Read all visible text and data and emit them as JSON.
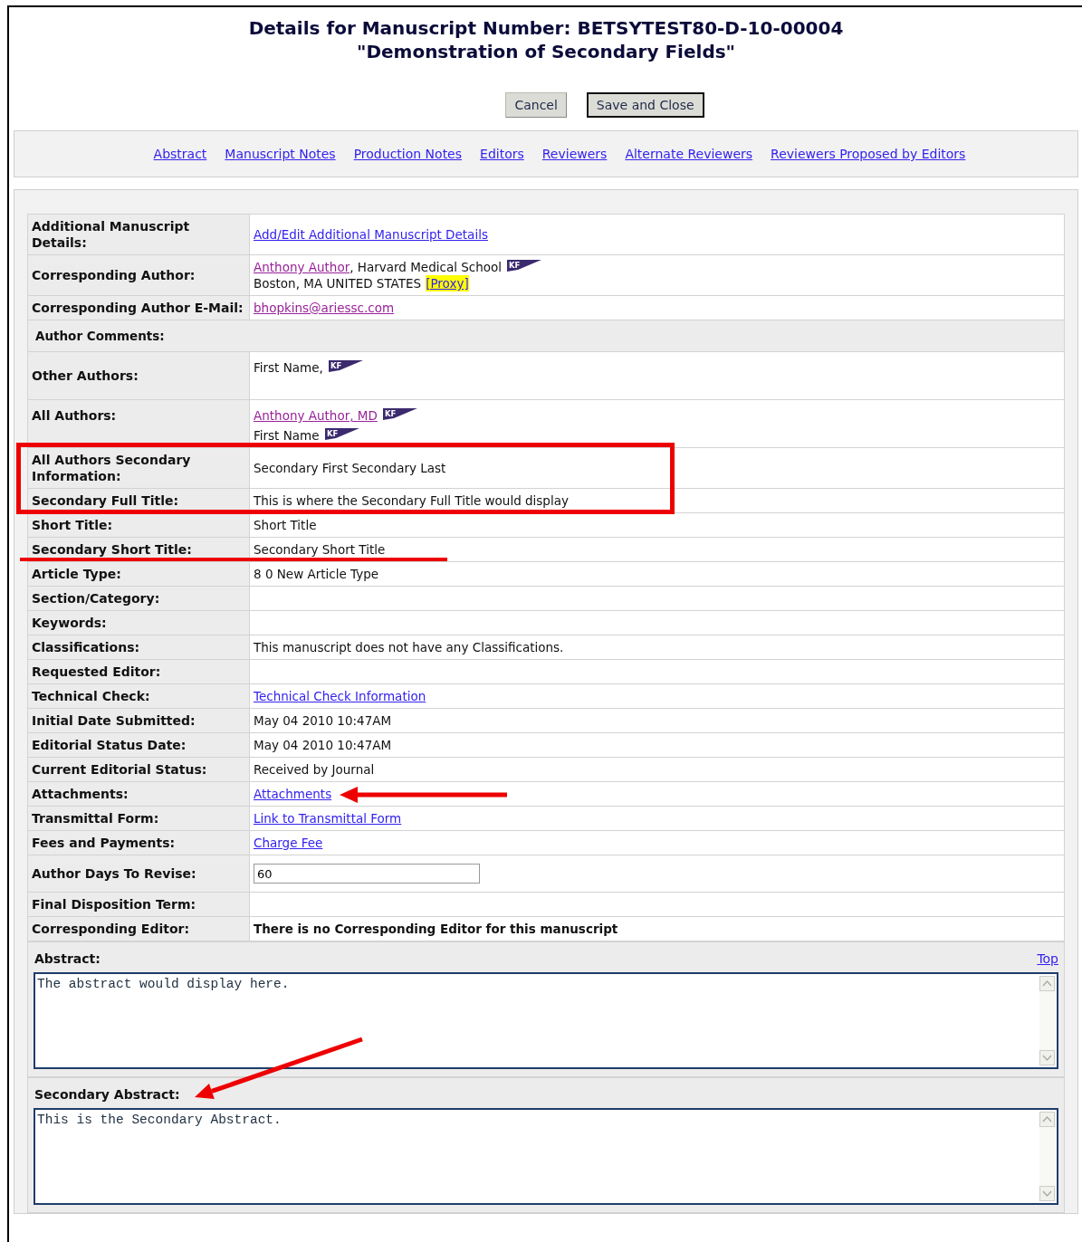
{
  "title": {
    "line1": "Details for Manuscript Number:  BETSYTEST80-D-10-00004",
    "line2": "\"Demonstration of Secondary Fields\""
  },
  "buttons": [
    {
      "label": "Cancel",
      "kind": "plain"
    },
    {
      "label": "Save and Close",
      "kind": "default"
    }
  ],
  "nav_links": [
    "Abstract",
    "Manuscript Notes",
    "Production Notes",
    "Editors",
    "Reviewers",
    "Alternate Reviewers",
    "Reviewers Proposed by Editors"
  ],
  "rows": [
    {
      "kind": "field",
      "label": "Additional Manuscript Details:",
      "lines": [
        [
          {
            "kind": "link",
            "text": "Add/Edit Additional Manuscript Details",
            "visited": false
          }
        ]
      ]
    },
    {
      "kind": "field",
      "label": "Corresponding Author:",
      "lines": [
        [
          {
            "kind": "link",
            "text": "Anthony Author",
            "visited": true
          },
          {
            "kind": "text",
            "text": ", Harvard Medical School"
          },
          {
            "kind": "flag",
            "text": "KF"
          }
        ],
        [
          {
            "kind": "text",
            "text": "Boston, MA UNITED STATES"
          },
          {
            "kind": "proxy",
            "text": "[Proxy]"
          }
        ]
      ]
    },
    {
      "kind": "field",
      "label": "Corresponding Author E-Mail:",
      "lines": [
        [
          {
            "kind": "link",
            "text": "bhopkins@ariessc.com",
            "visited": true
          }
        ]
      ]
    },
    {
      "kind": "section",
      "label": "Author Comments:"
    },
    {
      "kind": "list",
      "label": "Other Authors:",
      "lines": [
        [
          {
            "kind": "text",
            "text": "First Name,"
          },
          {
            "kind": "flag",
            "text": "KF"
          }
        ]
      ]
    },
    {
      "kind": "list",
      "label": "All Authors:",
      "lines": [
        [
          {
            "kind": "link",
            "text": "Anthony Author, MD",
            "visited": true
          },
          {
            "kind": "flag",
            "text": "KF"
          }
        ],
        [
          {
            "kind": "text",
            "text": "First Name"
          },
          {
            "kind": "flag",
            "text": "KF"
          }
        ]
      ]
    },
    {
      "kind": "field",
      "label": "All Authors Secondary Information:",
      "lines": [
        [
          {
            "kind": "text",
            "text": "Secondary First Secondary Last"
          }
        ]
      ]
    },
    {
      "kind": "field",
      "label": "Secondary Full Title:",
      "lines": [
        [
          {
            "kind": "text",
            "text": "This is where the Secondary Full Title would display"
          }
        ]
      ]
    },
    {
      "kind": "field",
      "label": "Short Title:",
      "lines": [
        [
          {
            "kind": "text",
            "text": "Short Title"
          }
        ]
      ]
    },
    {
      "kind": "field",
      "label": "Secondary Short Title:",
      "lines": [
        [
          {
            "kind": "text",
            "text": "Secondary Short Title"
          }
        ]
      ]
    },
    {
      "kind": "field",
      "label": "Article Type:",
      "lines": [
        [
          {
            "kind": "text",
            "text": "8 0 New Article Type"
          }
        ]
      ]
    },
    {
      "kind": "field",
      "label": "Section/Category:",
      "lines": []
    },
    {
      "kind": "field",
      "label": "Keywords:",
      "lines": []
    },
    {
      "kind": "field",
      "label": "Classifications:",
      "lines": [
        [
          {
            "kind": "text",
            "text": "This manuscript does not have any Classifications."
          }
        ]
      ]
    },
    {
      "kind": "field",
      "label": "Requested Editor:",
      "lines": []
    },
    {
      "kind": "field",
      "label": "Technical Check:",
      "lines": [
        [
          {
            "kind": "link",
            "text": "Technical Check Information",
            "visited": false
          }
        ]
      ]
    },
    {
      "kind": "field",
      "label": "Initial Date Submitted:",
      "lines": [
        [
          {
            "kind": "text",
            "text": "May 04 2010 10:47AM"
          }
        ]
      ]
    },
    {
      "kind": "field",
      "label": "Editorial Status Date:",
      "lines": [
        [
          {
            "kind": "text",
            "text": "May 04 2010 10:47AM"
          }
        ]
      ]
    },
    {
      "kind": "field",
      "label": "Current Editorial Status:",
      "lines": [
        [
          {
            "kind": "text",
            "text": "Received by Journal"
          }
        ]
      ]
    },
    {
      "kind": "field",
      "label": "Attachments:",
      "lines": [
        [
          {
            "kind": "link",
            "text": "Attachments",
            "visited": false
          }
        ]
      ]
    },
    {
      "kind": "field",
      "label": "Transmittal Form:",
      "lines": [
        [
          {
            "kind": "link",
            "text": "Link to Transmittal Form",
            "visited": false
          }
        ]
      ]
    },
    {
      "kind": "field",
      "label": "Fees and Payments:",
      "lines": [
        [
          {
            "kind": "link",
            "text": "Charge Fee",
            "visited": false
          }
        ]
      ]
    },
    {
      "kind": "input",
      "label": "Author Days To Revise:",
      "value": "60"
    },
    {
      "kind": "field",
      "label": "Final Disposition Term:",
      "lines": []
    },
    {
      "kind": "field",
      "label": "Corresponding Editor:",
      "lines": [
        [
          {
            "kind": "strong",
            "text": "There is no Corresponding Editor for this manuscript"
          }
        ]
      ]
    }
  ],
  "abstracts": [
    {
      "label": "Abstract:",
      "top_link": "Top",
      "text": "The abstract would display here."
    },
    {
      "label": "Secondary Abstract:",
      "text": "This is the Secondary Abstract."
    }
  ]
}
